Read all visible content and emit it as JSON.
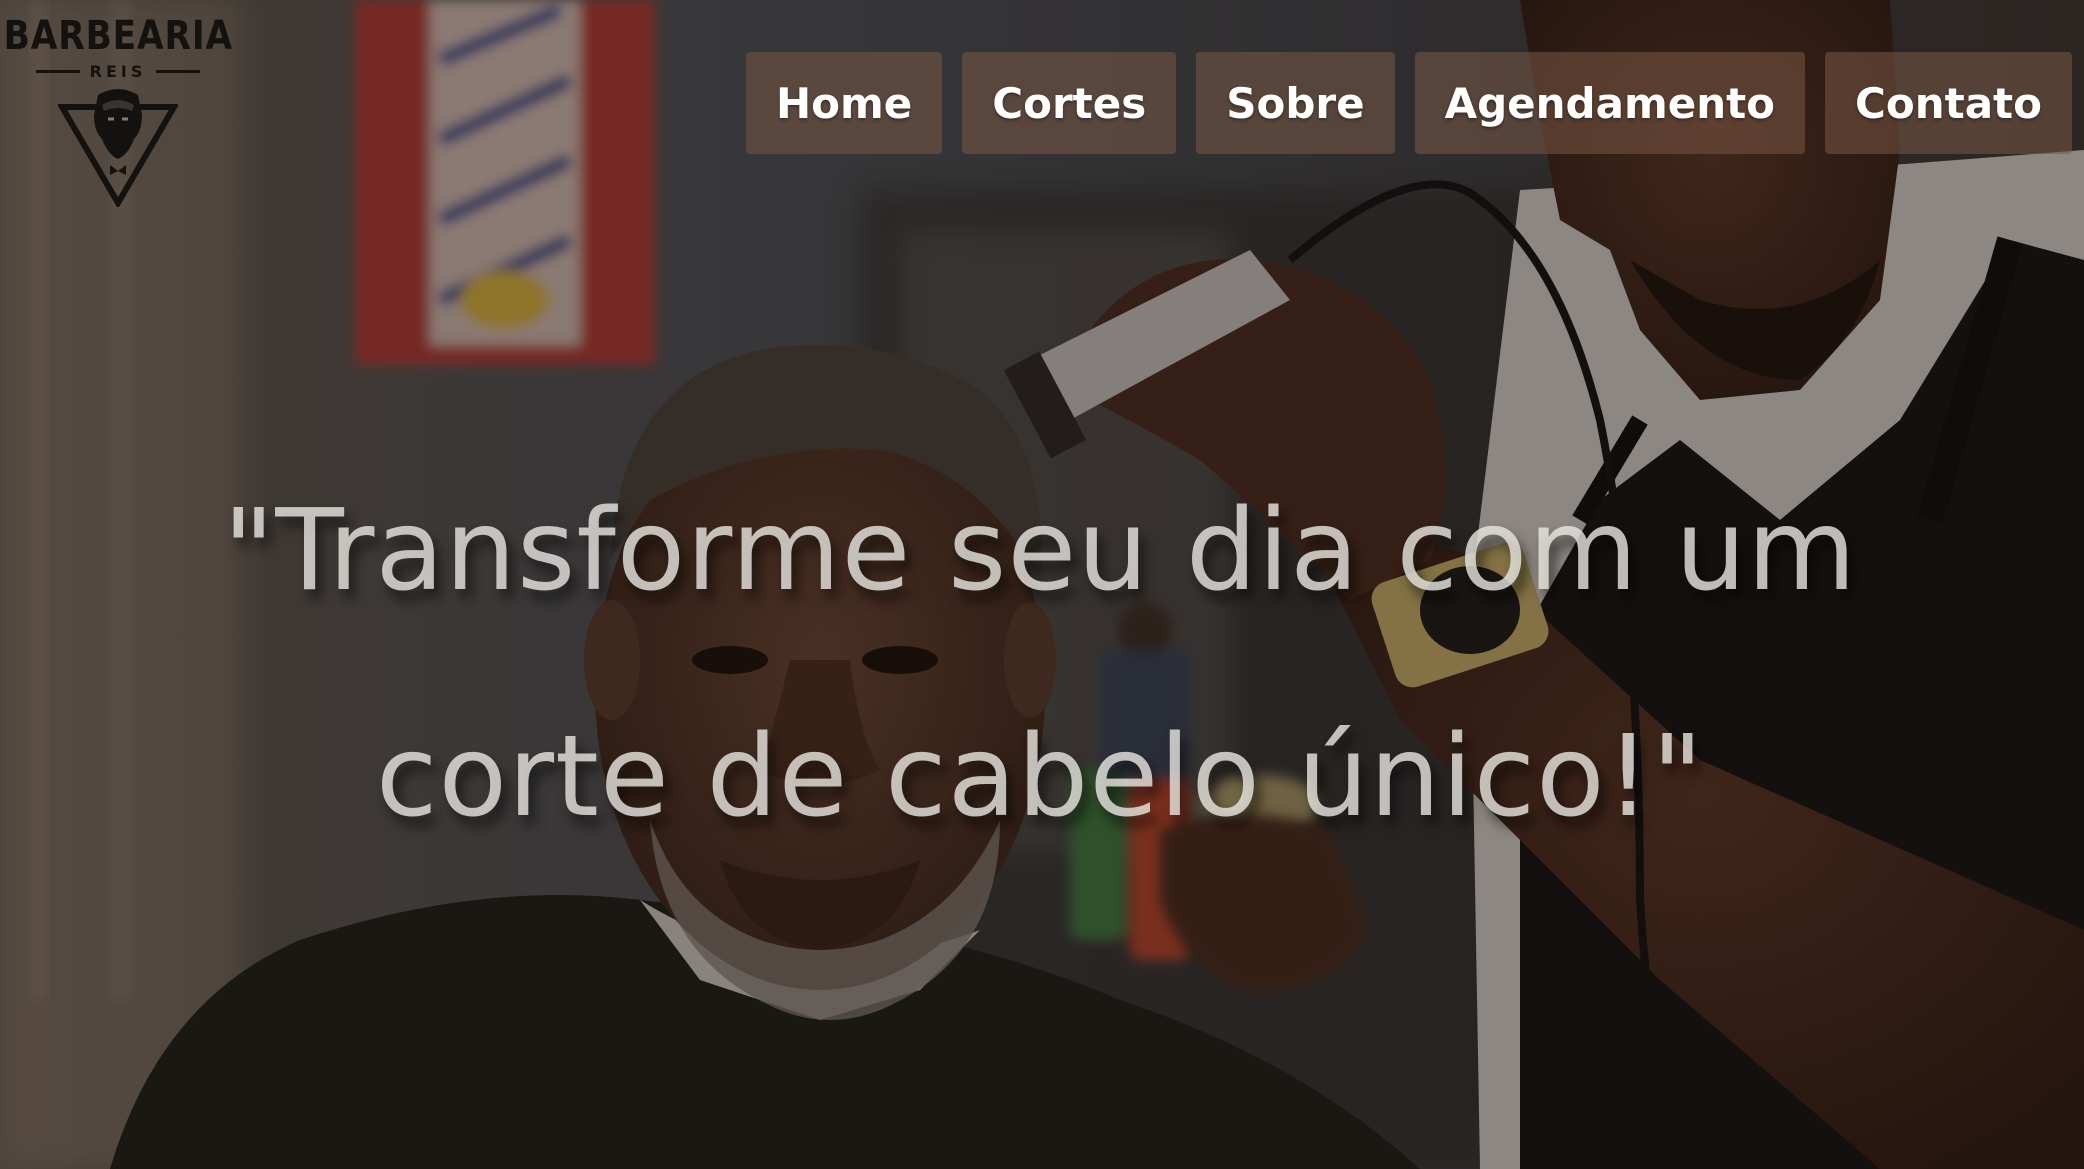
{
  "logo": {
    "title": "BARBEARIA",
    "subtitle": "REIS",
    "mark_icon": "bearded-man-triangle-icon"
  },
  "nav": {
    "items": [
      {
        "label": "Home"
      },
      {
        "label": "Cortes"
      },
      {
        "label": "Sobre"
      },
      {
        "label": "Agendamento"
      },
      {
        "label": "Contato"
      }
    ],
    "button_bg": "#785846"
  },
  "hero": {
    "headline": "\"Transforme seu dia com um corte de cabelo único!\"",
    "headline_color": "#ebe8e4"
  }
}
